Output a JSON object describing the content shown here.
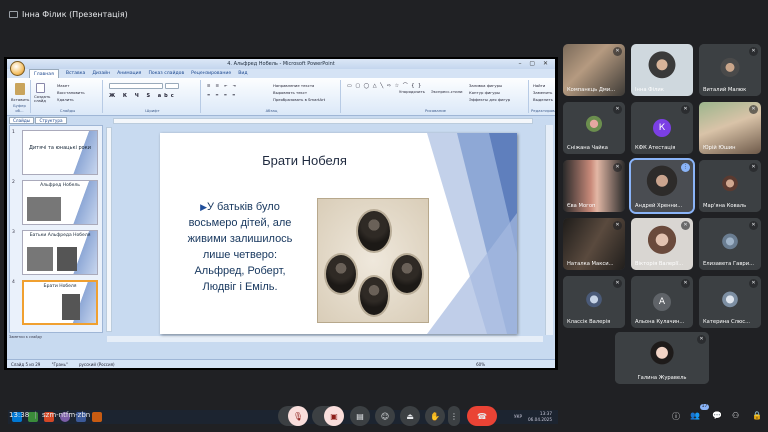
{
  "top": {
    "presenter_label": "Інна Філик (Презентація)"
  },
  "powerpoint": {
    "window_title": "4. Альфред Нобель - Microsoft PowerPoint",
    "tabs": [
      "Главная",
      "Вставка",
      "Дизайн",
      "Анимация",
      "Показ слайдов",
      "Рецензирование",
      "Вид"
    ],
    "groups": {
      "clipboard": {
        "label": "Буфер об...",
        "paste": "Вставить"
      },
      "slides": {
        "label": "Слайды",
        "create": "Создать слайд",
        "layout": "Макет",
        "restore": "Восстановить",
        "delete": "Удалить"
      },
      "font": {
        "label": "Шрифт"
      },
      "paragraph": {
        "label": "Абзац",
        "text_direction": "Направление текста",
        "align_text": "Выровнять текст",
        "smartart": "Преобразовать в SmartArt"
      },
      "drawing": {
        "label": "Рисование",
        "arrange": "Упорядочить",
        "quick_styles": "Экспресс-стили",
        "fill": "Заливка фигуры",
        "outline": "Контур фигуры",
        "effects": "Эффекты для фигур"
      },
      "editing": {
        "label": "Редактирование",
        "find": "Найти",
        "replace": "Заменить",
        "select": "Выделить"
      }
    },
    "pane_tabs": [
      "Слайды",
      "Структура"
    ],
    "thumbs": [
      {
        "num": "1",
        "title": "Дитячі та юнацькі роки"
      },
      {
        "num": "2",
        "title": "Альфред Нобель"
      },
      {
        "num": "3",
        "title": "Батьки Альфреда Нобеля"
      },
      {
        "num": "4",
        "title": "Брати Нобеля"
      }
    ],
    "slide": {
      "title": "Брати Нобеля",
      "bullet": "У батьків було восьмеро дітей, але живими залишилось лише четверо: Альфред, Роберт, Людвіг і Еміль."
    },
    "notes": "Заметки к слайду",
    "status": {
      "slide": "Слайд 5 из 29",
      "theme": "\"Грань\"",
      "language": "русский (Россия)",
      "zoom": "60%"
    },
    "taskbar": {
      "lang": "УКР",
      "time": "13:37",
      "date": "06.04.2025"
    }
  },
  "participants": [
    {
      "name": "Компанєць Дми...",
      "muted": true
    },
    {
      "name": "Інна Філик",
      "muted": false
    },
    {
      "name": "Виталий Малюк",
      "muted": true
    },
    {
      "name": "Сніжана Чайка",
      "muted": true
    },
    {
      "name": "КФК Атестація",
      "muted": true,
      "initial": "К",
      "avatar_color": "#7b3fe4"
    },
    {
      "name": "Юрій Юшин",
      "muted": true
    },
    {
      "name": "Єва Могоп",
      "muted": true
    },
    {
      "name": "Андрей Хренни...",
      "muted": false
    },
    {
      "name": "Мар'яна Коваль",
      "muted": true
    },
    {
      "name": "Наталка Макси...",
      "muted": true
    },
    {
      "name": "Вікторія Валерії...",
      "muted": true
    },
    {
      "name": "Елизавета Гаври...",
      "muted": true
    },
    {
      "name": "Классік Валерія",
      "muted": true
    },
    {
      "name": "Альона Кулачин...",
      "muted": true,
      "initial": "А",
      "avatar_color": "#5f6368"
    },
    {
      "name": "Катерина Слюс...",
      "muted": true
    },
    {
      "name": "Галина Журавель",
      "muted": true
    }
  ],
  "bottom": {
    "time": "13:38",
    "meeting_code": "szm-ntfm-zbn",
    "participants_count": "17"
  },
  "colors": {
    "bg": "#202124",
    "tile": "#3c4043",
    "hangup": "#ea4335",
    "speaking": "#8ab4f8"
  }
}
